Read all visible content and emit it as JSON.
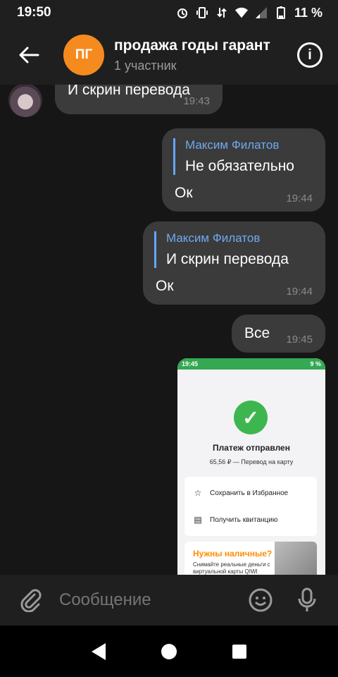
{
  "status_bar": {
    "time": "19:50",
    "battery": "11 %",
    "icons": [
      "alarm-icon",
      "vibrate-icon",
      "data-arrows-icon",
      "wifi-icon",
      "signal-icon",
      "battery-icon"
    ]
  },
  "header": {
    "avatar_initials": "ПГ",
    "avatar_color": "#f58b1f",
    "title": "продажа годы гарант",
    "subtitle": "1 участник"
  },
  "messages": [
    {
      "id": "m1",
      "incoming": true,
      "text": "И скрин перевода",
      "time": "19:43"
    },
    {
      "id": "m2",
      "incoming": false,
      "reply_name": "Максим Филатов",
      "reply_text": "Не обязательно",
      "text": "Ок",
      "time": "19:44"
    },
    {
      "id": "m3",
      "incoming": false,
      "reply_name": "Максим Филатов",
      "reply_text": "И скрин перевода",
      "text": "Ок",
      "time": "19:44"
    },
    {
      "id": "m4",
      "incoming": false,
      "text": "Все",
      "time": "19:45"
    }
  ],
  "screenshot_image": {
    "status_time": "19:45",
    "status_battery": "9 %",
    "title": "Платеж отправлен",
    "subtitle": "65,56 ₽ — Перевод на карту",
    "action_favorite": "Сохранить в Избранное",
    "action_receipt": "Получить квитанцию",
    "promo_title": "Нужны наличные?",
    "promo_text": "Снимайте реальные деньги с виртуальной карты QIWI"
  },
  "input": {
    "placeholder": "Сообщение"
  },
  "colors": {
    "bubble": "#3b3b3b",
    "quote_accent": "#6fa8f0",
    "background": "#161616"
  }
}
